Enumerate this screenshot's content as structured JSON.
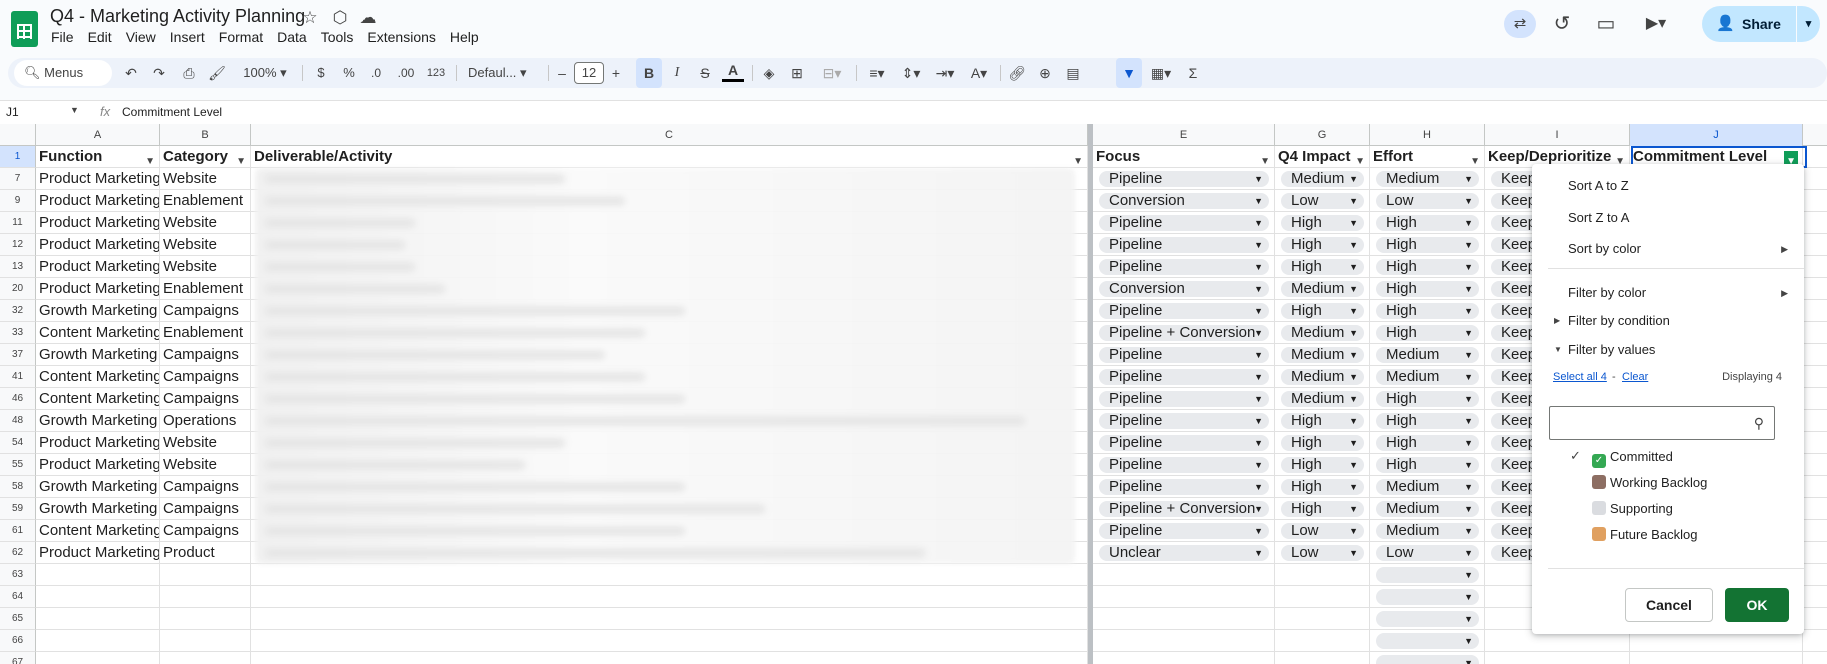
{
  "app": {
    "doc_title": "Q4 - Marketing Activity Planning",
    "menu": [
      "File",
      "Edit",
      "View",
      "Insert",
      "Format",
      "Data",
      "Tools",
      "Extensions",
      "Help"
    ],
    "share_label": "Share"
  },
  "toolbar": {
    "menus_label": "Menus",
    "zoom": "100%",
    "currency": "$",
    "percent": "%",
    "dec_decrease": ".0",
    "dec_increase": ".00",
    "number_format": "123",
    "font": "Defaul...",
    "font_size": "12",
    "minus": "–",
    "plus": "+"
  },
  "formula_bar": {
    "cell_ref": "J1",
    "fx": "fx",
    "content": "Commitment Level"
  },
  "columns": [
    "A",
    "B",
    "C",
    "E",
    "G",
    "H",
    "I",
    "J"
  ],
  "header_row": {
    "num": "1",
    "function": "Function",
    "category": "Category",
    "deliverable": "Deliverable/Activity",
    "focus": "Focus",
    "impact": "Q4 Impact",
    "effort": "Effort",
    "keep": "Keep/Deprioritize",
    "commitment": "Commitment Level"
  },
  "rows": [
    {
      "num": "7",
      "function": "Product Marketing",
      "category": "Website",
      "focus": "Pipeline",
      "impact": "Medium",
      "effort": "Medium",
      "keep": "Keep"
    },
    {
      "num": "9",
      "function": "Product Marketing",
      "category": "Enablement",
      "focus": "Conversion",
      "impact": "Low",
      "effort": "Low",
      "keep": "Keep"
    },
    {
      "num": "11",
      "function": "Product Marketing",
      "category": "Website",
      "focus": "Pipeline",
      "impact": "High",
      "effort": "High",
      "keep": "Keep"
    },
    {
      "num": "12",
      "function": "Product Marketing",
      "category": "Website",
      "focus": "Pipeline",
      "impact": "High",
      "effort": "High",
      "keep": "Keep"
    },
    {
      "num": "13",
      "function": "Product Marketing",
      "category": "Website",
      "focus": "Pipeline",
      "impact": "High",
      "effort": "High",
      "keep": "Keep"
    },
    {
      "num": "20",
      "function": "Product Marketing",
      "category": "Enablement",
      "focus": "Conversion",
      "impact": "Medium",
      "effort": "High",
      "keep": "Keep"
    },
    {
      "num": "32",
      "function": "Growth Marketing",
      "category": "Campaigns",
      "focus": "Pipeline",
      "impact": "High",
      "effort": "High",
      "keep": "Keep"
    },
    {
      "num": "33",
      "function": "Content Marketing",
      "category": "Enablement",
      "focus": "Pipeline + Conversion",
      "impact": "Medium",
      "effort": "High",
      "keep": "Keep"
    },
    {
      "num": "37",
      "function": "Growth Marketing",
      "category": "Campaigns",
      "focus": "Pipeline",
      "impact": "Medium",
      "effort": "Medium",
      "keep": "Keep"
    },
    {
      "num": "41",
      "function": "Content Marketing",
      "category": "Campaigns",
      "focus": "Pipeline",
      "impact": "Medium",
      "effort": "Medium",
      "keep": "Keep"
    },
    {
      "num": "46",
      "function": "Content Marketing",
      "category": "Campaigns",
      "focus": "Pipeline",
      "impact": "Medium",
      "effort": "High",
      "keep": "Keep"
    },
    {
      "num": "48",
      "function": "Growth Marketing",
      "category": "Operations",
      "focus": "Pipeline",
      "impact": "High",
      "effort": "High",
      "keep": "Keep"
    },
    {
      "num": "54",
      "function": "Product Marketing",
      "category": "Website",
      "focus": "Pipeline",
      "impact": "High",
      "effort": "High",
      "keep": "Keep"
    },
    {
      "num": "55",
      "function": "Product Marketing",
      "category": "Website",
      "focus": "Pipeline",
      "impact": "High",
      "effort": "High",
      "keep": "Keep"
    },
    {
      "num": "58",
      "function": "Growth Marketing",
      "category": "Campaigns",
      "focus": "Pipeline",
      "impact": "High",
      "effort": "Medium",
      "keep": "Keep"
    },
    {
      "num": "59",
      "function": "Growth Marketing",
      "category": "Campaigns",
      "focus": "Pipeline + Conversion",
      "impact": "High",
      "effort": "Medium",
      "keep": "Keep"
    },
    {
      "num": "61",
      "function": "Content Marketing",
      "category": "Campaigns",
      "focus": "Pipeline",
      "impact": "Low",
      "effort": "Medium",
      "keep": "Keep"
    },
    {
      "num": "62",
      "function": "Product Marketing",
      "category": "Product",
      "focus": "Unclear",
      "impact": "Low",
      "effort": "Low",
      "keep": "Keep"
    }
  ],
  "empty_rows": [
    "63",
    "64",
    "65",
    "66",
    "67"
  ],
  "filter_panel": {
    "sort_az": "Sort A to Z",
    "sort_za": "Sort Z to A",
    "sort_color": "Sort by color",
    "filter_color": "Filter by color",
    "filter_condition": "Filter by condition",
    "filter_values": "Filter by values",
    "select_all": "Select all 4",
    "dash": "-",
    "clear": "Clear",
    "displaying": "Displaying 4",
    "values": [
      {
        "label": "Committed",
        "checked": true,
        "icon": "check-box-emoji",
        "color": "#34a853"
      },
      {
        "label": "Working Backlog",
        "checked": false,
        "icon": "hourglass-emoji",
        "color": "#8d6e63"
      },
      {
        "label": "Supporting",
        "checked": false,
        "icon": "white-circle-emoji",
        "color": "#dadce0"
      },
      {
        "label": "Future Backlog",
        "checked": false,
        "icon": "box-emoji",
        "color": "#e0a060"
      }
    ],
    "cancel": "Cancel",
    "ok": "OK"
  }
}
